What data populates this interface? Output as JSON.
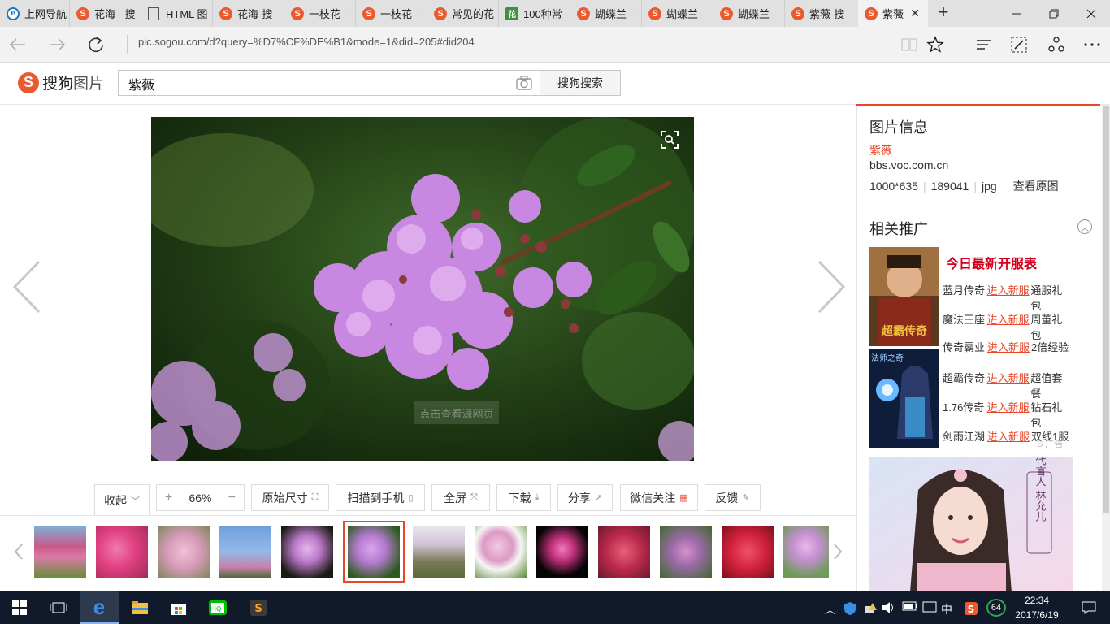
{
  "browser": {
    "tabs": [
      {
        "title": "上网导航",
        "icon": "ie-icon"
      },
      {
        "title": "花海 - 搜",
        "icon": "sogou-icon"
      },
      {
        "title": "HTML 图",
        "icon": "page-icon"
      },
      {
        "title": "花海-搜",
        "icon": "sogou-icon"
      },
      {
        "title": "一枝花 -",
        "icon": "sogou-icon"
      },
      {
        "title": "一枝花 -",
        "icon": "sogou-icon"
      },
      {
        "title": "常见的花",
        "icon": "sogou-icon"
      },
      {
        "title": "100种常",
        "icon": "flower-icon"
      },
      {
        "title": "蝴蝶兰 -",
        "icon": "sogou-icon"
      },
      {
        "title": "蝴蝶兰-",
        "icon": "sogou-icon"
      },
      {
        "title": "蝴蝶兰-",
        "icon": "sogou-icon"
      },
      {
        "title": "紫薇-搜",
        "icon": "sogou-icon"
      },
      {
        "title": "紫薇",
        "icon": "sogou-icon"
      }
    ],
    "url": "pic.sogou.com/d?query=%D7%CF%DE%B1&mode=1&did=205#did204"
  },
  "header": {
    "logo_brand": "搜狗",
    "logo_product": "图片",
    "search_value": "紫薇",
    "search_button": "搜狗搜索"
  },
  "viewer": {
    "view_source": "点击查看源网页",
    "toolbar": {
      "collapse": "收起",
      "zoom_level": "66%",
      "original_size": "原始尺寸",
      "scan_to_phone": "扫描到手机",
      "fullscreen": "全屏",
      "download": "下载",
      "share": "分享",
      "wechat_follow": "微信关注",
      "feedback": "反馈"
    },
    "thumbnails_count": 13,
    "selected_thumbnail": 5
  },
  "side": {
    "info_title": "图片信息",
    "image_name": "紫薇",
    "source_domain": "bbs.voc.com.cn",
    "dimensions": "1000*635",
    "file_size": "189041",
    "format": "jpg",
    "view_original": "查看原图",
    "promo_title": "相关推广",
    "ad_heading": "今日最新开服表",
    "ad_rows": [
      {
        "game": "蓝月传奇",
        "enter": "进入新服",
        "gift": "通服礼包"
      },
      {
        "game": "魔法王座",
        "enter": "进入新服",
        "gift": "周董礼包"
      },
      {
        "game": "传奇霸业",
        "enter": "进入新服",
        "gift": "2倍经验"
      },
      {
        "game": "超霸传奇",
        "enter": "进入新服",
        "gift": "超值套餐"
      },
      {
        "game": "1.76传奇",
        "enter": "进入新服",
        "gift": "钻石礼包"
      },
      {
        "game": "剑雨江湖",
        "enter": "进入新服",
        "gift": "双线1服"
      }
    ],
    "ad_label": "广告",
    "banner_text": "代言人 林允儿",
    "ad_img1_text": "超霸传奇",
    "ad_img2_text": "法师之奇"
  },
  "taskbar": {
    "time": "22:34",
    "date": "2017/6/19",
    "ime": "中",
    "badge": "64"
  },
  "colors": {
    "accent": "#e8462a",
    "brand": "#ea5a2e",
    "ad_red": "#d3001d"
  }
}
